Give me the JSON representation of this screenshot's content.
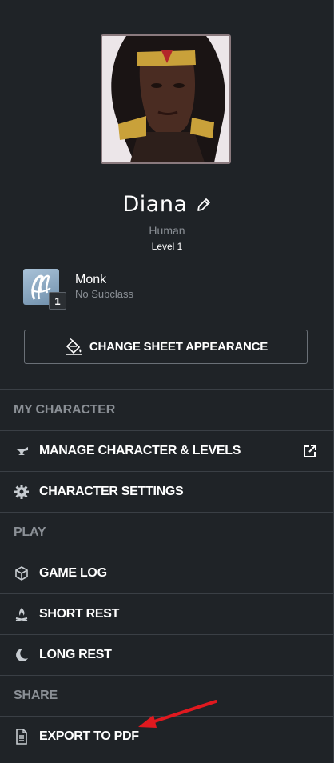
{
  "character": {
    "name": "Diana",
    "race": "Human",
    "level": "Level 1"
  },
  "class": {
    "name": "Monk",
    "subclass": "No Subclass",
    "level": "1"
  },
  "appearance_button": "CHANGE SHEET APPEARANCE",
  "menu": {
    "my_character": "MY CHARACTER",
    "manage": "MANAGE CHARACTER & LEVELS",
    "settings": "CHARACTER SETTINGS",
    "play": "PLAY",
    "game_log": "GAME LOG",
    "short_rest": "SHORT REST",
    "long_rest": "LONG REST",
    "share": "SHARE",
    "export_pdf": "EXPORT TO PDF"
  },
  "colors": {
    "background": "#1f2327",
    "muted_text": "#8b9096",
    "annotation_arrow": "#e0191f"
  }
}
